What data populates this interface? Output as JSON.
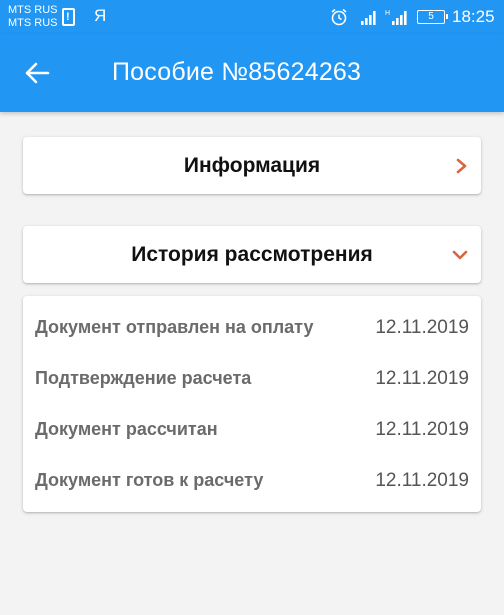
{
  "status_bar": {
    "carrier_1": "MTS RUS",
    "carrier_2": "MTS RUS",
    "sim_warning": "!",
    "yandex_glyph": "Я",
    "signal_1_label": "H",
    "signal_2_label": "H",
    "battery_level": "5",
    "time": "18:25"
  },
  "app_bar": {
    "title": "Пособие №85624263"
  },
  "sections": {
    "info_label": "Информация",
    "history_label": "История рассмотрения"
  },
  "history": [
    {
      "name": "Документ отправлен на оплату",
      "date": "12.11.2019"
    },
    {
      "name": "Подтверждение расчета",
      "date": "12.11.2019"
    },
    {
      "name": "Документ рассчитан",
      "date": "12.11.2019"
    },
    {
      "name": "Документ готов к расчету",
      "date": "12.11.2019"
    }
  ],
  "colors": {
    "primary": "#2196f3",
    "chevron": "#d9673e",
    "background": "#f3f3f3"
  }
}
